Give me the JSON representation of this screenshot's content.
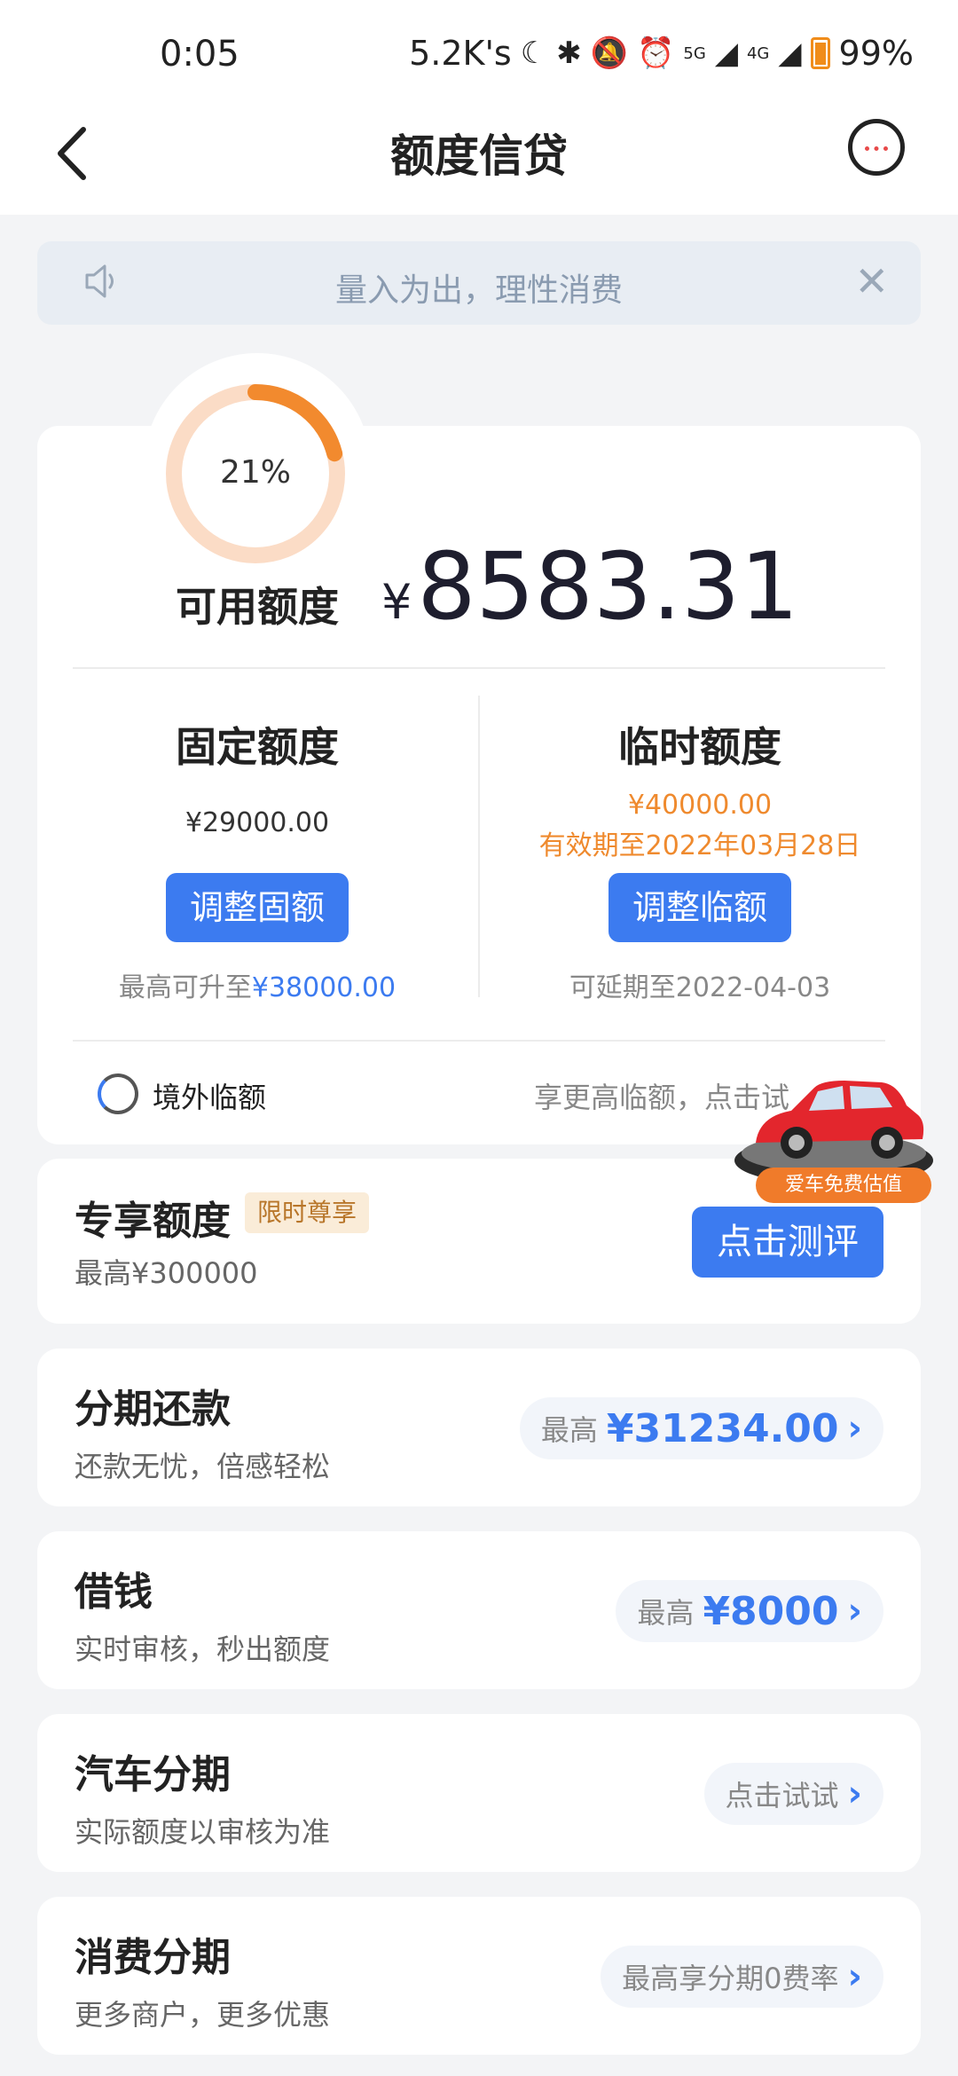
{
  "status_bar": {
    "time": "0:05",
    "net_speed": "5.2K's",
    "signal_5g": "5G",
    "signal_4g": "4G",
    "battery": "99%"
  },
  "header": {
    "title": "额度信贷",
    "back_icon": "chevron-left-icon",
    "assistant_icon": "cat-assistant-icon"
  },
  "notice": {
    "text": "量入为出，理性消费",
    "speaker_icon": "speaker-icon",
    "close_icon": "close-icon"
  },
  "credit": {
    "usage_percent_label": "21%",
    "usage_fraction": 0.21,
    "available_label": "可用额度",
    "currency": "¥",
    "available_amount": "8583.31",
    "fixed": {
      "title": "固定额度",
      "amount": "¥29000.00",
      "button": "调整固额",
      "note_prefix": "最高可升至",
      "note_value": "¥38000.00"
    },
    "temporary": {
      "title": "临时额度",
      "amount": "¥40000.00",
      "validity": "有效期至2022年03月28日",
      "button": "调整临额",
      "note": "可延期至2022-04-03"
    },
    "overseas": {
      "label": "境外临额",
      "hint": "享更高临额，点击试"
    }
  },
  "car_promo": {
    "label": "爱车免费估值"
  },
  "exclusive": {
    "title": "专享额度",
    "tag": "限时尊享",
    "subtitle": "最高¥300000",
    "button": "点击测评"
  },
  "list": [
    {
      "title": "分期还款",
      "subtitle": "还款无忧，倍感轻松",
      "pill_prefix": "最高",
      "pill_value": "¥31234.00"
    },
    {
      "title": "借钱",
      "subtitle": "实时审核，秒出额度",
      "pill_prefix": "最高",
      "pill_value": "¥8000"
    },
    {
      "title": "汽车分期",
      "subtitle": "实际额度以审核为准",
      "pill_prefix": "点击试试",
      "pill_value": ""
    },
    {
      "title": "消费分期",
      "subtitle": "更多商户，更多优惠",
      "pill_prefix": "最高享分期0费率",
      "pill_value": ""
    }
  ],
  "colors": {
    "accent_blue": "#3c7bf0",
    "ring_orange": "#f28a2e",
    "ring_track": "#fbdcc6",
    "temp_orange": "#ef8a2e"
  }
}
